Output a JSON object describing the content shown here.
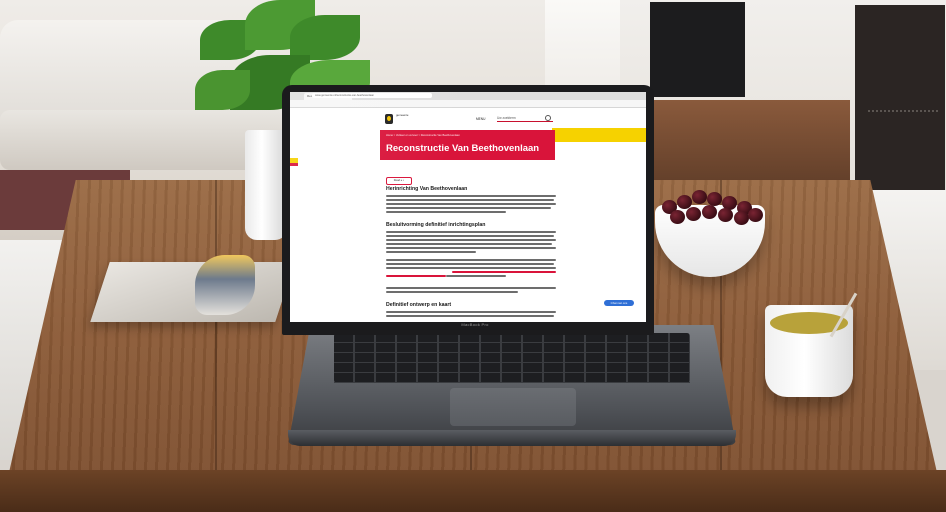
{
  "laptop": {
    "brand": "MacBook Pro"
  },
  "browser": {
    "tab_title": "Reconstructie Van Beethovenlaan",
    "url": "www.gemeente.nl/reconstructie-van-beethovenlaan"
  },
  "site": {
    "logo_text": "gemeente",
    "menu_label": "MENU",
    "search_placeholder": "Uw zoekterm",
    "breadcrumb": "Home > Verkeer en vervoer > Reconstructie Van Beethovenlaan",
    "page_title": "Reconstructie Van Beethovenlaan",
    "language_button": "Read ≡ ♪",
    "sections": [
      {
        "heading": "Herinrichting Van Beethovenlaan"
      },
      {
        "heading": "Besluitvorming definitief inrichtingsplan"
      },
      {
        "heading": "Definitief ontwerp en kaart"
      }
    ],
    "chat_button": "Chat met ons"
  },
  "colors": {
    "brand_red": "#d9143a",
    "brand_yellow": "#f6d200"
  }
}
